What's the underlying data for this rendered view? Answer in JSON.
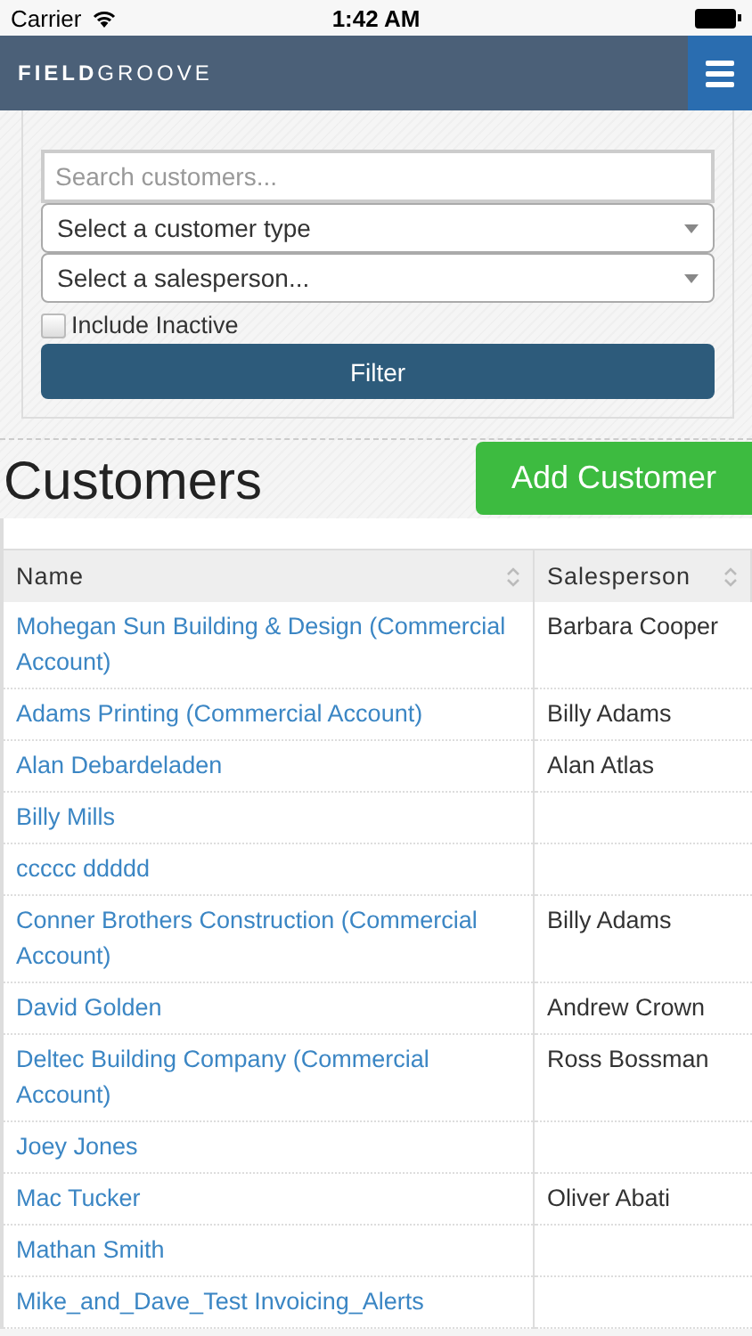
{
  "status_bar": {
    "carrier": "Carrier",
    "time": "1:42 AM"
  },
  "navbar": {
    "logo": "**FIELD**GROOVE"
  },
  "filters": {
    "search": {
      "placeholder": "Search customers..."
    },
    "selects": [
      {
        "label": "Select a customer type"
      },
      {
        "label": "Select a salesperson..."
      }
    ],
    "include_inactive": {
      "label": "Include Inactive",
      "checked": false
    },
    "filter_button": "Filter"
  },
  "heading": "Customers",
  "add_button": "Add Customer",
  "table": {
    "columns": [
      "Name",
      "Salesperson"
    ],
    "rows": [
      {
        "name": "Mohegan Sun Building & Design (Commercial Account)",
        "salesperson": "Barbara Cooper"
      },
      {
        "name": "Adams Printing (Commercial Account)",
        "salesperson": "Billy Adams"
      },
      {
        "name": "Alan Debardeladen",
        "salesperson": "Alan Atlas"
      },
      {
        "name": "Billy Mills"
      },
      {
        "name": "ccccc ddddd"
      },
      {
        "name": "Conner Brothers Construction (Commercial Account)",
        "salesperson": "Billy Adams"
      },
      {
        "name": "David Golden",
        "salesperson": "Andrew Crown"
      },
      {
        "name": "Deltec Building Company (Commercial Account)",
        "salesperson": "Ross Bossman"
      },
      {
        "name": "Joey Jones"
      },
      {
        "name": "Mac Tucker",
        "salesperson": "Oliver Abati"
      },
      {
        "name": "Mathan Smith"
      },
      {
        "name": "Mike_and_Dave_Test Invoicing_Alerts"
      }
    ]
  }
}
